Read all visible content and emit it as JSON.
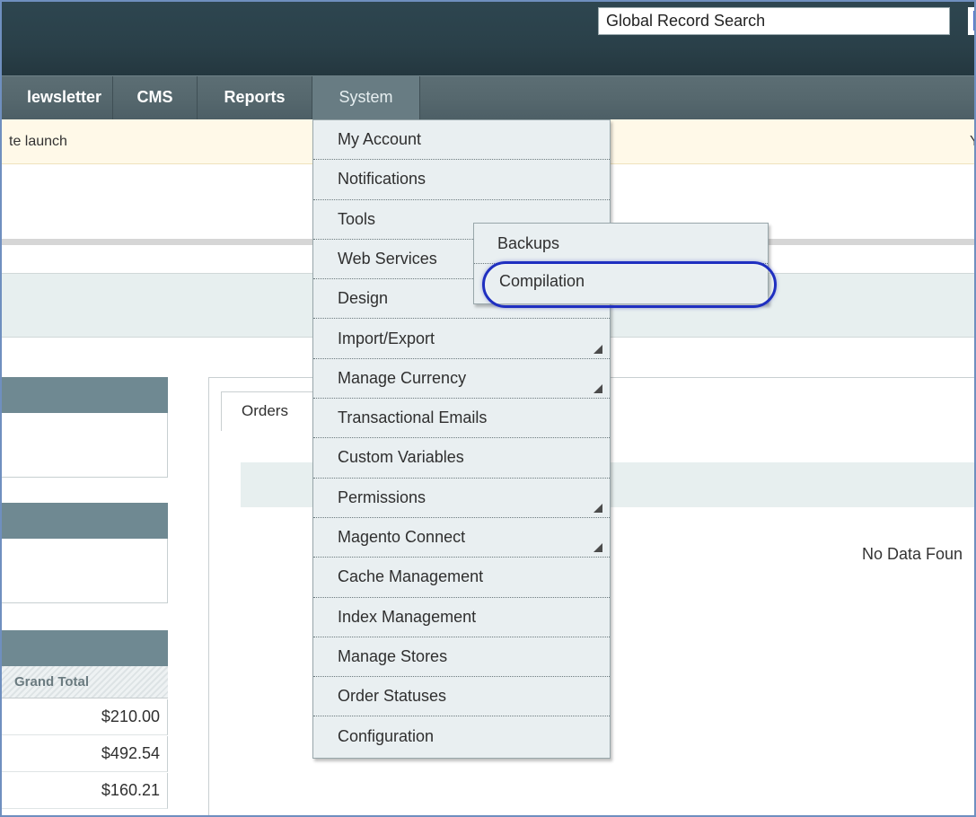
{
  "header": {
    "search": {
      "value": "Global Record Search",
      "placeholder": "Global Record Search"
    }
  },
  "nav": {
    "items": [
      {
        "label": "lewsletter"
      },
      {
        "label": "CMS"
      },
      {
        "label": "Reports"
      },
      {
        "label": "System",
        "active": true
      }
    ]
  },
  "notice": {
    "left_text": "te launch",
    "right_text": "Y"
  },
  "system_menu": {
    "items": [
      {
        "label": "My Account",
        "has_submenu": false
      },
      {
        "label": "Notifications",
        "has_submenu": false
      },
      {
        "label": "Tools",
        "has_submenu": false
      },
      {
        "label": "Web Services",
        "has_submenu": false
      },
      {
        "label": "Design",
        "has_submenu": false
      },
      {
        "label": "Import/Export",
        "has_submenu": true
      },
      {
        "label": "Manage Currency",
        "has_submenu": true
      },
      {
        "label": "Transactional Emails",
        "has_submenu": false
      },
      {
        "label": "Custom Variables",
        "has_submenu": false
      },
      {
        "label": "Permissions",
        "has_submenu": true
      },
      {
        "label": "Magento Connect",
        "has_submenu": true
      },
      {
        "label": "Cache Management",
        "has_submenu": false
      },
      {
        "label": "Index Management",
        "has_submenu": false
      },
      {
        "label": "Manage Stores",
        "has_submenu": false
      },
      {
        "label": "Order Statuses",
        "has_submenu": false
      },
      {
        "label": "Configuration",
        "has_submenu": false
      }
    ]
  },
  "tools_submenu": {
    "items": [
      {
        "label": "Backups"
      },
      {
        "label": "Compilation",
        "highlighted": true
      }
    ]
  },
  "dashboard": {
    "tab_orders": "Orders",
    "no_data": "No Data Foun",
    "grand_total_header": "Grand Total",
    "grand_totals": [
      "$210.00",
      "$492.54",
      "$160.21"
    ]
  },
  "colors": {
    "header_bg": "#2a4049",
    "nav_bg": "#56686e",
    "menu_bg": "#e9eff1",
    "highlight_ring": "#1f2fc0",
    "notice_bg": "#fff9e8"
  }
}
